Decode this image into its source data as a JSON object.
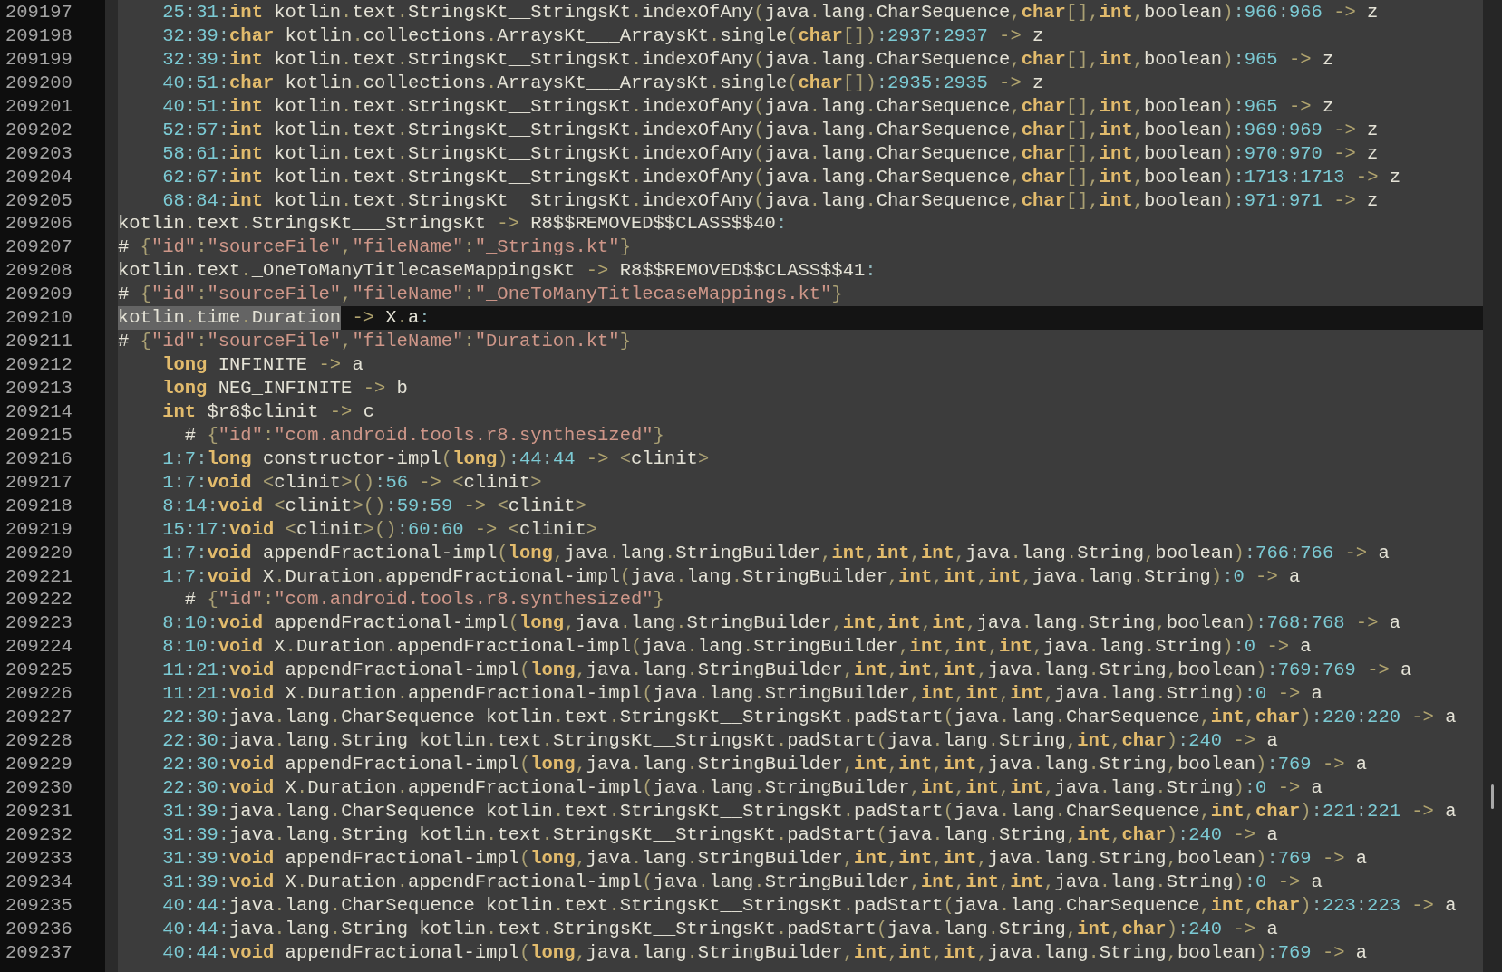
{
  "editor": {
    "lines": [
      {
        "number": "209197",
        "current": false,
        "text": "    25:31:int kotlin.text.StringsKt__StringsKt.indexOfAny(java.lang.CharSequence,char[],int,boolean):966:966 -> z"
      },
      {
        "number": "209198",
        "current": false,
        "text": "    32:39:char kotlin.collections.ArraysKt___ArraysKt.single(char[]):2937:2937 -> z"
      },
      {
        "number": "209199",
        "current": false,
        "text": "    32:39:int kotlin.text.StringsKt__StringsKt.indexOfAny(java.lang.CharSequence,char[],int,boolean):965 -> z"
      },
      {
        "number": "209200",
        "current": false,
        "text": "    40:51:char kotlin.collections.ArraysKt___ArraysKt.single(char[]):2935:2935 -> z"
      },
      {
        "number": "209201",
        "current": false,
        "text": "    40:51:int kotlin.text.StringsKt__StringsKt.indexOfAny(java.lang.CharSequence,char[],int,boolean):965 -> z"
      },
      {
        "number": "209202",
        "current": false,
        "text": "    52:57:int kotlin.text.StringsKt__StringsKt.indexOfAny(java.lang.CharSequence,char[],int,boolean):969:969 -> z"
      },
      {
        "number": "209203",
        "current": false,
        "text": "    58:61:int kotlin.text.StringsKt__StringsKt.indexOfAny(java.lang.CharSequence,char[],int,boolean):970:970 -> z"
      },
      {
        "number": "209204",
        "current": false,
        "text": "    62:67:int kotlin.text.StringsKt__StringsKt.indexOfAny(java.lang.CharSequence,char[],int,boolean):1713:1713 -> z"
      },
      {
        "number": "209205",
        "current": false,
        "text": "    68:84:int kotlin.text.StringsKt__StringsKt.indexOfAny(java.lang.CharSequence,char[],int,boolean):971:971 -> z"
      },
      {
        "number": "209206",
        "current": false,
        "text": "kotlin.text.StringsKt___StringsKt -> R8$$REMOVED$$CLASS$$40:"
      },
      {
        "number": "209207",
        "current": false,
        "text": "# {\"id\":\"sourceFile\",\"fileName\":\"_Strings.kt\"}"
      },
      {
        "number": "209208",
        "current": false,
        "text": "kotlin.text._OneToManyTitlecaseMappingsKt -> R8$$REMOVED$$CLASS$$41:"
      },
      {
        "number": "209209",
        "current": false,
        "text": "# {\"id\":\"sourceFile\",\"fileName\":\"_OneToManyTitlecaseMappings.kt\"}"
      },
      {
        "number": "209210",
        "current": true,
        "selection": "kotlin.time.Duration",
        "text": " -> X.a:"
      },
      {
        "number": "209211",
        "current": false,
        "text": "# {\"id\":\"sourceFile\",\"fileName\":\"Duration.kt\"}"
      },
      {
        "number": "209212",
        "current": false,
        "text": "    long INFINITE -> a"
      },
      {
        "number": "209213",
        "current": false,
        "text": "    long NEG_INFINITE -> b"
      },
      {
        "number": "209214",
        "current": false,
        "text": "    int $r8$clinit -> c"
      },
      {
        "number": "209215",
        "current": false,
        "text": "      # {\"id\":\"com.android.tools.r8.synthesized\"}"
      },
      {
        "number": "209216",
        "current": false,
        "text": "    1:7:long constructor-impl(long):44:44 -> <clinit>"
      },
      {
        "number": "209217",
        "current": false,
        "text": "    1:7:void <clinit>():56 -> <clinit>"
      },
      {
        "number": "209218",
        "current": false,
        "text": "    8:14:void <clinit>():59:59 -> <clinit>"
      },
      {
        "number": "209219",
        "current": false,
        "text": "    15:17:void <clinit>():60:60 -> <clinit>"
      },
      {
        "number": "209220",
        "current": false,
        "text": "    1:7:void appendFractional-impl(long,java.lang.StringBuilder,int,int,int,java.lang.String,boolean):766:766 -> a"
      },
      {
        "number": "209221",
        "current": false,
        "text": "    1:7:void X.Duration.appendFractional-impl(java.lang.StringBuilder,int,int,int,java.lang.String):0 -> a"
      },
      {
        "number": "209222",
        "current": false,
        "text": "      # {\"id\":\"com.android.tools.r8.synthesized\"}"
      },
      {
        "number": "209223",
        "current": false,
        "text": "    8:10:void appendFractional-impl(long,java.lang.StringBuilder,int,int,int,java.lang.String,boolean):768:768 -> a"
      },
      {
        "number": "209224",
        "current": false,
        "text": "    8:10:void X.Duration.appendFractional-impl(java.lang.StringBuilder,int,int,int,java.lang.String):0 -> a"
      },
      {
        "number": "209225",
        "current": false,
        "text": "    11:21:void appendFractional-impl(long,java.lang.StringBuilder,int,int,int,java.lang.String,boolean):769:769 -> a"
      },
      {
        "number": "209226",
        "current": false,
        "text": "    11:21:void X.Duration.appendFractional-impl(java.lang.StringBuilder,int,int,int,java.lang.String):0 -> a"
      },
      {
        "number": "209227",
        "current": false,
        "text": "    22:30:java.lang.CharSequence kotlin.text.StringsKt__StringsKt.padStart(java.lang.CharSequence,int,char):220:220 -> a"
      },
      {
        "number": "209228",
        "current": false,
        "text": "    22:30:java.lang.String kotlin.text.StringsKt__StringsKt.padStart(java.lang.String,int,char):240 -> a"
      },
      {
        "number": "209229",
        "current": false,
        "text": "    22:30:void appendFractional-impl(long,java.lang.StringBuilder,int,int,int,java.lang.String,boolean):769 -> a"
      },
      {
        "number": "209230",
        "current": false,
        "text": "    22:30:void X.Duration.appendFractional-impl(java.lang.StringBuilder,int,int,int,java.lang.String):0 -> a"
      },
      {
        "number": "209231",
        "current": false,
        "text": "    31:39:java.lang.CharSequence kotlin.text.StringsKt__StringsKt.padStart(java.lang.CharSequence,int,char):221:221 -> a"
      },
      {
        "number": "209232",
        "current": false,
        "text": "    31:39:java.lang.String kotlin.text.StringsKt__StringsKt.padStart(java.lang.String,int,char):240 -> a"
      },
      {
        "number": "209233",
        "current": false,
        "text": "    31:39:void appendFractional-impl(long,java.lang.StringBuilder,int,int,int,java.lang.String,boolean):769 -> a"
      },
      {
        "number": "209234",
        "current": false,
        "text": "    31:39:void X.Duration.appendFractional-impl(java.lang.StringBuilder,int,int,int,java.lang.String):0 -> a"
      },
      {
        "number": "209235",
        "current": false,
        "text": "    40:44:java.lang.CharSequence kotlin.text.StringsKt__StringsKt.padStart(java.lang.CharSequence,int,char):223:223 -> a"
      },
      {
        "number": "209236",
        "current": false,
        "text": "    40:44:java.lang.String kotlin.text.StringsKt__StringsKt.padStart(java.lang.String,int,char):240 -> a"
      },
      {
        "number": "209237",
        "current": false,
        "text": "    40:44:void appendFractional-impl(long,java.lang.StringBuilder,int,int,int,java.lang.String,boolean):769 -> a"
      }
    ]
  }
}
